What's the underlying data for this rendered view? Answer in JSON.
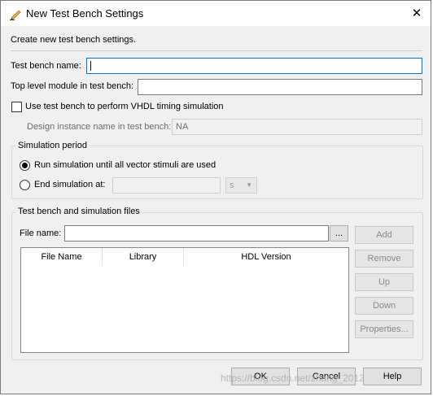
{
  "window": {
    "title": "New Test Bench Settings",
    "close_glyph": "✕"
  },
  "intro": "Create new test bench settings.",
  "fields": {
    "test_bench_name_label": "Test bench name:",
    "test_bench_name_value": "",
    "top_level_module_label": "Top level module in test bench:",
    "top_level_module_value": ""
  },
  "vhdl_timing": {
    "checkbox_label": "Use test bench to perform VHDL timing simulation",
    "checked": false,
    "instance_label": "Design instance name in test bench:",
    "instance_value": "NA"
  },
  "simulation_period": {
    "title": "Simulation period",
    "run_label": "Run simulation until all vector stimuli are used",
    "end_label": "End simulation at:",
    "end_value": "",
    "unit": "s",
    "selected": "run"
  },
  "files": {
    "title": "Test bench and simulation files",
    "file_name_label": "File name:",
    "file_name_value": "",
    "browse_label": "...",
    "columns": [
      "File Name",
      "Library",
      "HDL Version"
    ],
    "rows": [],
    "buttons": {
      "add": "Add",
      "remove": "Remove",
      "up": "Up",
      "down": "Down",
      "properties": "Properties..."
    }
  },
  "footer": {
    "ok": "OK",
    "cancel": "Cancel",
    "help": "Help"
  },
  "watermark": "https://blog.csdn.net/zhang_2012"
}
